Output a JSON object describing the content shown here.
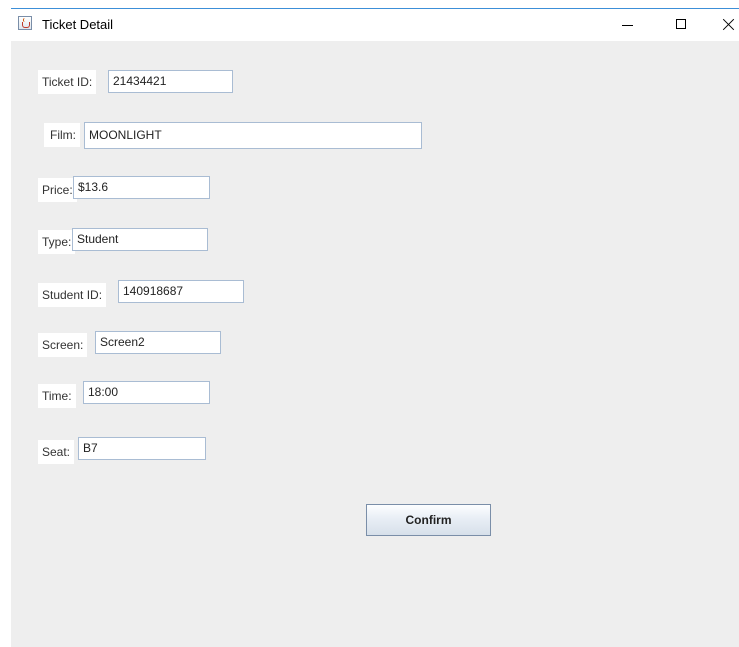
{
  "window": {
    "title": "Ticket Detail",
    "icon": "java-cup-icon",
    "controls": [
      "minimize",
      "maximize",
      "close"
    ]
  },
  "form": {
    "ticket_id": {
      "label": "Ticket ID:",
      "value": "21434421"
    },
    "film": {
      "label": "Film:",
      "value": "MOONLIGHT"
    },
    "price": {
      "label": "Price:",
      "value": "$13.6"
    },
    "type": {
      "label": "Type:",
      "value": "Student"
    },
    "student_id": {
      "label": "Student ID:",
      "value": "140918687"
    },
    "screen": {
      "label": "Screen:",
      "value": "Screen2"
    },
    "time": {
      "label": "Time:",
      "value": "18:00"
    },
    "seat": {
      "label": "Seat:",
      "value": "B7"
    }
  },
  "actions": {
    "confirm_label": "Confirm"
  },
  "colors": {
    "panel_background": "#eeeeee",
    "field_border": "#a9bcd3",
    "window_border": "#3c8fd8"
  }
}
